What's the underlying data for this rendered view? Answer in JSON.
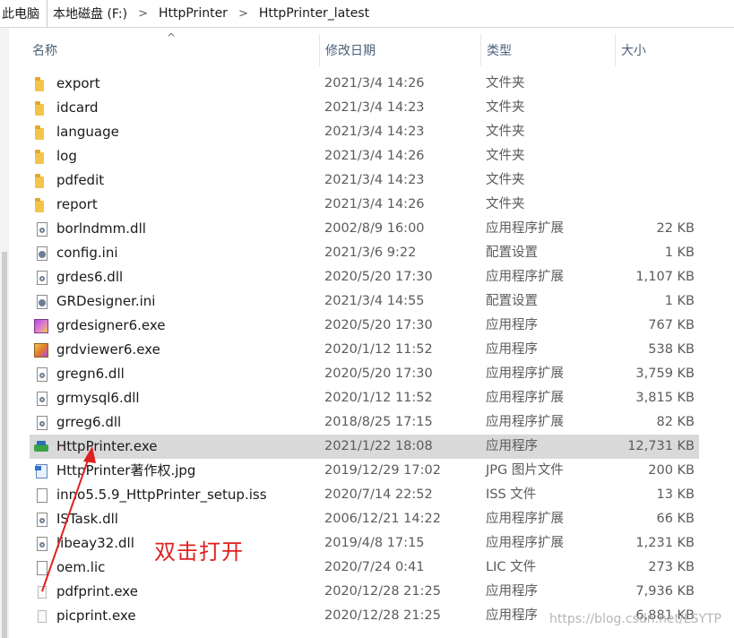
{
  "breadcrumb": [
    "此电脑",
    "本地磁盘 (F:)",
    "HttpPrinter",
    "HttpPrinter_latest"
  ],
  "columns": {
    "name": "名称",
    "date": "修改日期",
    "type": "类型",
    "size": "大小"
  },
  "files": [
    {
      "name": "export",
      "date": "2021/3/4 14:26",
      "type": "文件夹",
      "size": "",
      "icon": "folder-icon"
    },
    {
      "name": "idcard",
      "date": "2021/3/4 14:23",
      "type": "文件夹",
      "size": "",
      "icon": "folder-icon"
    },
    {
      "name": "language",
      "date": "2021/3/4 14:23",
      "type": "文件夹",
      "size": "",
      "icon": "folder-icon"
    },
    {
      "name": "log",
      "date": "2021/3/4 14:26",
      "type": "文件夹",
      "size": "",
      "icon": "folder-icon"
    },
    {
      "name": "pdfedit",
      "date": "2021/3/4 14:23",
      "type": "文件夹",
      "size": "",
      "icon": "folder-icon"
    },
    {
      "name": "report",
      "date": "2021/3/4 14:26",
      "type": "文件夹",
      "size": "",
      "icon": "folder-icon"
    },
    {
      "name": "borlndmm.dll",
      "date": "2002/8/9 16:00",
      "type": "应用程序扩展",
      "size": "22 KB",
      "icon": "dll-file-icon"
    },
    {
      "name": "config.ini",
      "date": "2021/3/6 9:22",
      "type": "配置设置",
      "size": "1 KB",
      "icon": "settings-file-icon"
    },
    {
      "name": "grdes6.dll",
      "date": "2020/5/20 17:30",
      "type": "应用程序扩展",
      "size": "1,107 KB",
      "icon": "dll-file-icon"
    },
    {
      "name": "GRDesigner.ini",
      "date": "2021/3/4 14:55",
      "type": "配置设置",
      "size": "1 KB",
      "icon": "settings-file-icon"
    },
    {
      "name": "grdesigner6.exe",
      "date": "2020/5/20 17:30",
      "type": "应用程序",
      "size": "767 KB",
      "icon": "designer-app-icon"
    },
    {
      "name": "grdviewer6.exe",
      "date": "2020/1/12 11:52",
      "type": "应用程序",
      "size": "538 KB",
      "icon": "viewer-app-icon"
    },
    {
      "name": "gregn6.dll",
      "date": "2020/5/20 17:30",
      "type": "应用程序扩展",
      "size": "3,759 KB",
      "icon": "dll-file-icon"
    },
    {
      "name": "grmysql6.dll",
      "date": "2020/1/12 11:52",
      "type": "应用程序扩展",
      "size": "3,815 KB",
      "icon": "dll-file-icon"
    },
    {
      "name": "grreg6.dll",
      "date": "2018/8/25 17:15",
      "type": "应用程序扩展",
      "size": "82 KB",
      "icon": "dll-file-icon"
    },
    {
      "name": "HttpPrinter.exe",
      "date": "2021/1/22 18:08",
      "type": "应用程序",
      "size": "12,731 KB",
      "icon": "printer-app-icon",
      "selected": true
    },
    {
      "name": "HttpPrinter著作权.jpg",
      "date": "2019/12/29 17:02",
      "type": "JPG 图片文件",
      "size": "200 KB",
      "icon": "image-file-icon"
    },
    {
      "name": "inno5.5.9_HttpPrinter_setup.iss",
      "date": "2020/7/14 22:52",
      "type": "ISS 文件",
      "size": "13 KB",
      "icon": "blank-file-icon"
    },
    {
      "name": "ISTask.dll",
      "date": "2006/12/21 14:22",
      "type": "应用程序扩展",
      "size": "66 KB",
      "icon": "dll-file-icon"
    },
    {
      "name": "libeay32.dll",
      "date": "2019/4/8 17:15",
      "type": "应用程序扩展",
      "size": "1,231 KB",
      "icon": "dll-file-icon"
    },
    {
      "name": "oem.lic",
      "date": "2020/7/24 0:41",
      "type": "LIC 文件",
      "size": "273 KB",
      "icon": "blank-file-icon"
    },
    {
      "name": "pdfprint.exe",
      "date": "2020/12/28 21:25",
      "type": "应用程序",
      "size": "7,936 KB",
      "icon": "exe-file-icon"
    },
    {
      "name": "picprint.exe",
      "date": "2020/12/28 21:25",
      "type": "应用程序",
      "size": "6,881 KB",
      "icon": "exe-file-icon"
    }
  ],
  "annotation": {
    "text": "双击打开",
    "color": "#e02020"
  },
  "watermark": "https://blog.csdn.net/LSYTP",
  "colors": {
    "selected_row": "#d9d9d9",
    "header_text": "#4c607a",
    "folder": "#f3c44a"
  }
}
